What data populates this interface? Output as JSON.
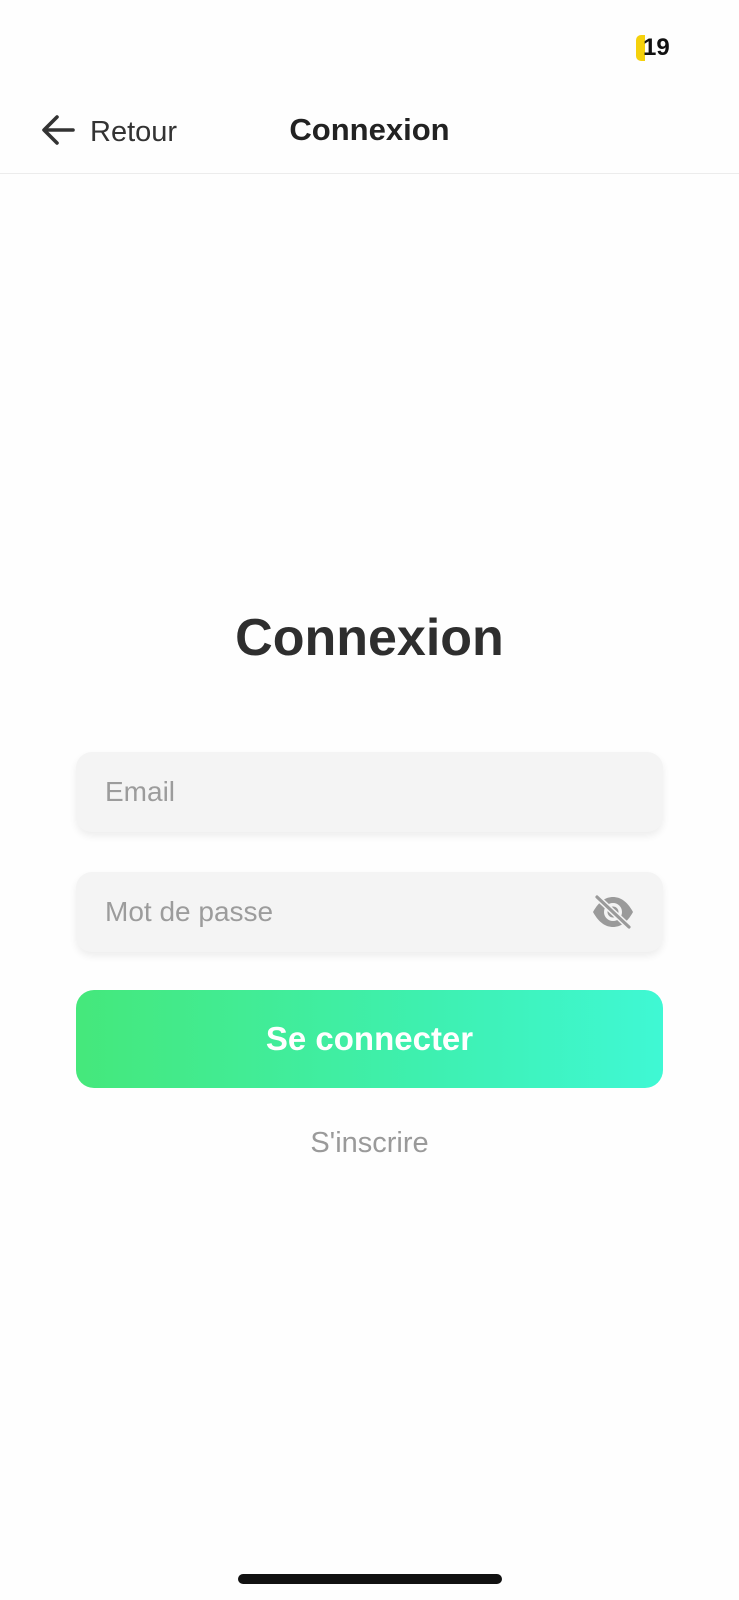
{
  "status_bar": {
    "battery_level_text": "19",
    "battery_color": "#f5d10c"
  },
  "header": {
    "back_label": "Retour",
    "title": "Connexion",
    "back_icon": "arrow-left-icon"
  },
  "main": {
    "title": "Connexion",
    "email": {
      "value": "",
      "placeholder": "Email"
    },
    "password": {
      "value": "",
      "placeholder": "Mot de passe",
      "toggle_icon": "eye-slash-icon"
    },
    "login_label": "Se connecter",
    "signup_label": "S'inscrire"
  },
  "colors": {
    "accent_gradient_start": "#45e87b",
    "accent_gradient_end": "#3ff8d4",
    "field_background": "#f4f4f4"
  }
}
